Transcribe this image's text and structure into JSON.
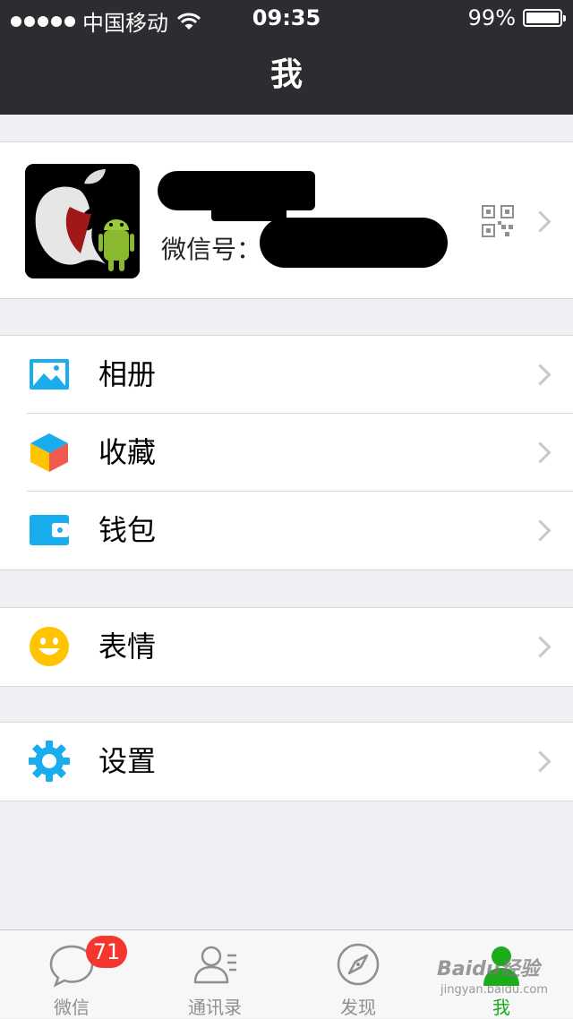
{
  "status": {
    "carrier": "中国移动",
    "time": "09:35",
    "battery": "99%",
    "battery_level": 0.99
  },
  "nav": {
    "title": "我"
  },
  "profile": {
    "wechat_id_label": "微信号："
  },
  "menu": [
    {
      "label": "相册",
      "icon": "photo-album-icon"
    },
    {
      "label": "收藏",
      "icon": "favorites-cube-icon"
    },
    {
      "label": "钱包",
      "icon": "wallet-icon"
    },
    {
      "label": "表情",
      "icon": "smiley-icon"
    },
    {
      "label": "设置",
      "icon": "gear-icon"
    }
  ],
  "tabs": [
    {
      "label": "微信",
      "badge": "71",
      "icon": "chat-bubble-icon"
    },
    {
      "label": "通讯录",
      "icon": "contacts-icon"
    },
    {
      "label": "发现",
      "icon": "compass-icon"
    },
    {
      "label": "我",
      "icon": "person-icon",
      "active": true
    }
  ],
  "watermark": {
    "brand": "Baidu经验",
    "url": "jingyan.baidu.com"
  },
  "colors": {
    "accent": "#1aad19",
    "icon_blue": "#1aadee",
    "badge": "#f43530",
    "nav_bg": "#2d2d31"
  }
}
